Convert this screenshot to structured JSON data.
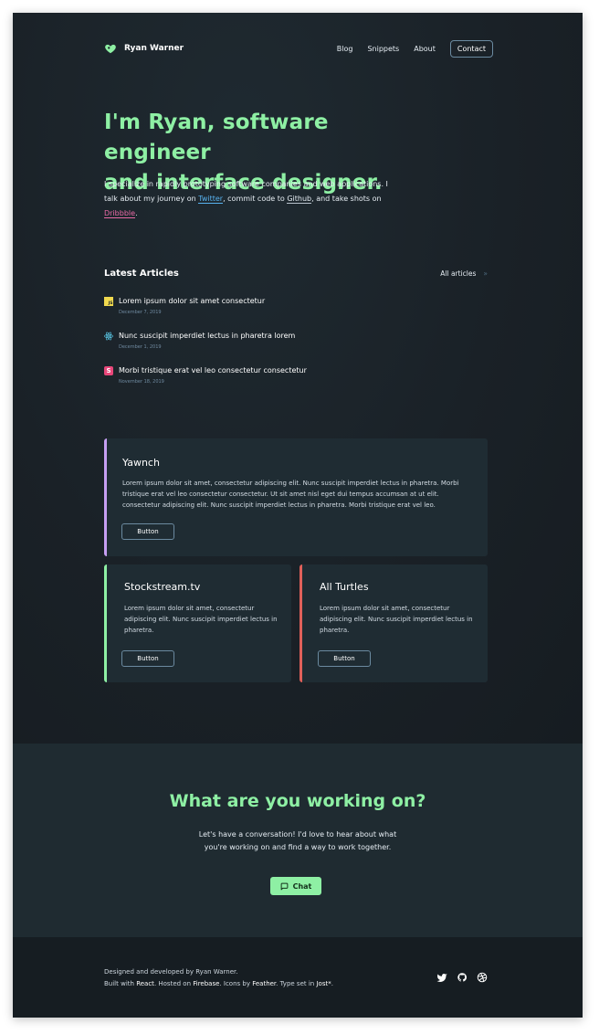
{
  "nav": {
    "brand": "Ryan Warner",
    "links": [
      "Blog",
      "Snippets",
      "About"
    ],
    "contact": "Contact"
  },
  "hero": {
    "title_line1": "I'm Ryan, software engineer",
    "title_line2": "and interface designer.",
    "text_a": "I specialize in rapidly prototyping software companies and web applications. I talk about my journey on ",
    "twitter": "Twitter",
    "text_b": ", commit code to ",
    "github": "Github",
    "text_c": ", and take shots on ",
    "dribbble": "Dribbble",
    "text_d": "."
  },
  "articles": {
    "heading": "Latest Articles",
    "all_label": "All articles",
    "chevron": "»",
    "items": [
      {
        "title": "Lorem ipsum dolor sit amet consectetur",
        "date": "December 7, 2019",
        "icon": "javascript-icon",
        "icon_text": "JS",
        "color": "#f0d94e"
      },
      {
        "title": "Nunc suscipit imperdiet lectus in pharetra lorem",
        "date": "December 1, 2019",
        "icon": "react-icon",
        "color": "#61dafb"
      },
      {
        "title": "Morbi tristique erat vel leo consectetur consectetur",
        "date": "November 18, 2019",
        "icon": "svelte-icon",
        "icon_text": "S",
        "color": "#e8477a"
      }
    ]
  },
  "cards": [
    {
      "title": "Yawnch",
      "text": "Lorem ipsum dolor sit amet, consectetur adipiscing elit. Nunc suscipit imperdiet lectus in pharetra. Morbi tristique erat vel leo consectetur consectetur. Ut sit amet nisl eget dui tempus accumsan at ut elit. consectetur adipiscing elit. Nunc suscipit imperdiet lectus in pharetra. Morbi tristique erat vel leo.",
      "button": "Button",
      "accent": "#c69ef2"
    },
    {
      "title": "Stockstream.tv",
      "text": "Lorem ipsum dolor sit amet, consectetur adipiscing elit. Nunc suscipit imperdiet lectus in pharetra.",
      "button": "Button",
      "accent": "#8ef0a4"
    },
    {
      "title": "All Turtles",
      "text": "Lorem ipsum dolor sit amet, consectetur adipiscing elit. Nunc suscipit imperdiet lectus in pharetra.",
      "button": "Button",
      "accent": "#e0605a"
    }
  ],
  "cta": {
    "title": "What are you working on?",
    "text": "Let's have a conversation! I'd love to hear about what you're working on and find a way to work together.",
    "button": "Chat"
  },
  "footer": {
    "line1": "Designed and developed by Ryan Warner.",
    "built_with": "Built with ",
    "react": "React",
    "hosted_on": ". Hosted on ",
    "firebase": "Firebase",
    "icons_by": ". Icons by ",
    "feather": "Feather",
    "type_set": ". Type set in ",
    "jost": "Jost*",
    "end": ".",
    "icons": [
      "twitter-icon",
      "github-icon",
      "dribbble-icon"
    ]
  },
  "colors": {
    "background": "#1b2329",
    "accent_green": "#8ef0a4",
    "twitter_blue": "#58b3f0",
    "dribbble_pink": "#ea6aa6"
  }
}
